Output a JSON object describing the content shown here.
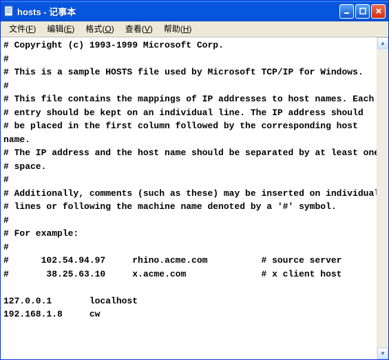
{
  "titlebar": {
    "title": "hosts - 记事本"
  },
  "menubar": {
    "file": "文件(F)",
    "edit": "编辑(E)",
    "format": "格式(O)",
    "view": "查看(V)",
    "help": "帮助(H)"
  },
  "content": {
    "text": "# Copyright (c) 1993-1999 Microsoft Corp.\n#\n# This is a sample HOSTS file used by Microsoft TCP/IP for Windows.\n#\n# This file contains the mappings of IP addresses to host names. Each\n# entry should be kept on an individual line. The IP address should\n# be placed in the first column followed by the corresponding host name.\n# The IP address and the host name should be separated by at least one\n# space.\n#\n# Additionally, comments (such as these) may be inserted on individual\n# lines or following the machine name denoted by a '#' symbol.\n#\n# For example:\n#\n#      102.54.94.97     rhino.acme.com          # source server\n#       38.25.63.10     x.acme.com              # x client host\n\n127.0.0.1       localhost\n192.168.1.8     cw"
  }
}
